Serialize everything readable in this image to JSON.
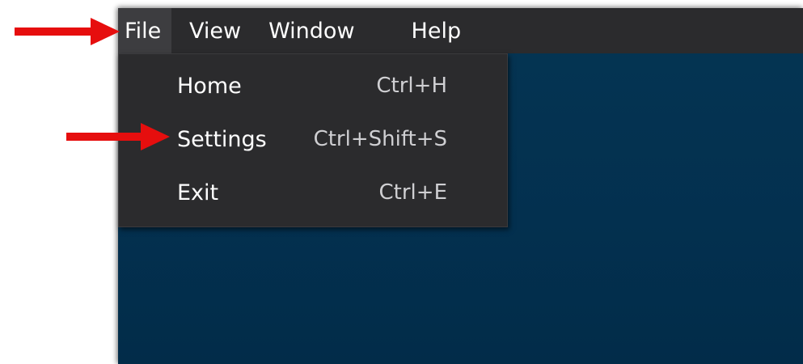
{
  "menu_bar": {
    "items": [
      {
        "label": "File"
      },
      {
        "label": "View"
      },
      {
        "label": "Window"
      },
      {
        "label": "Help"
      }
    ]
  },
  "file_menu": {
    "items": [
      {
        "label": "Home",
        "shortcut": "Ctrl+H"
      },
      {
        "label": "Settings",
        "shortcut": "Ctrl+Shift+S"
      },
      {
        "label": "Exit",
        "shortcut": "Ctrl+E"
      }
    ]
  },
  "colors": {
    "menu_bar_bg": "#2b2b2d",
    "menu_active_bg": "#3d3d40",
    "desktop_bg": "#03304f",
    "annotation_arrow": "#e60e0e"
  },
  "annotations": [
    {
      "name": "arrow",
      "points_to": "File"
    },
    {
      "name": "arrow",
      "points_to": "Settings"
    }
  ]
}
